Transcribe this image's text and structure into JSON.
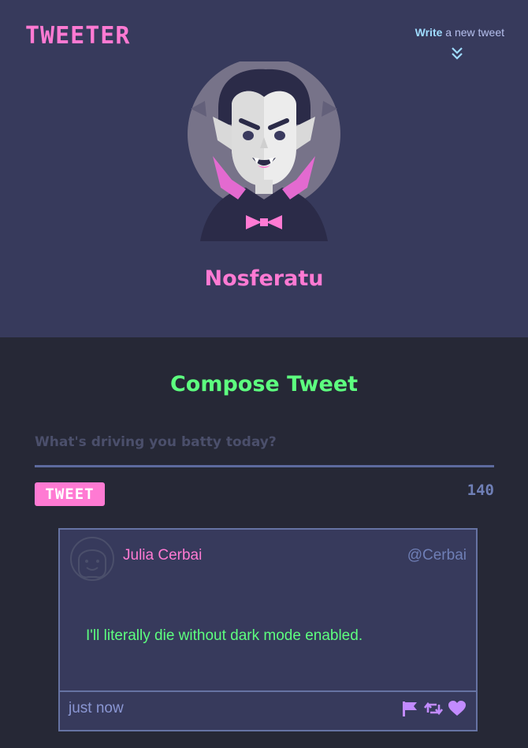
{
  "header": {
    "logo": "Tweeter",
    "write_link_bold": "Write",
    "write_link_rest": " a new tweet",
    "profile_name": "Nosferatu"
  },
  "compose": {
    "title": "Compose Tweet",
    "placeholder": "What's driving you batty today?",
    "button_label": "TWEET",
    "counter": "140"
  },
  "tweets": [
    {
      "name": "Julia Cerbai",
      "handle": "@Cerbai",
      "text": "I'll literally die without dark mode enabled.",
      "time": "just now",
      "actions": [
        "flag-icon",
        "retweet-icon",
        "heart-icon"
      ]
    }
  ],
  "colors": {
    "header_bg": "#373a5c",
    "page_bg": "#262836",
    "pink": "#ff7ad3",
    "green": "#5dff7f",
    "muted_blue": "#6f7fb6",
    "action_purple": "#c28bff"
  }
}
